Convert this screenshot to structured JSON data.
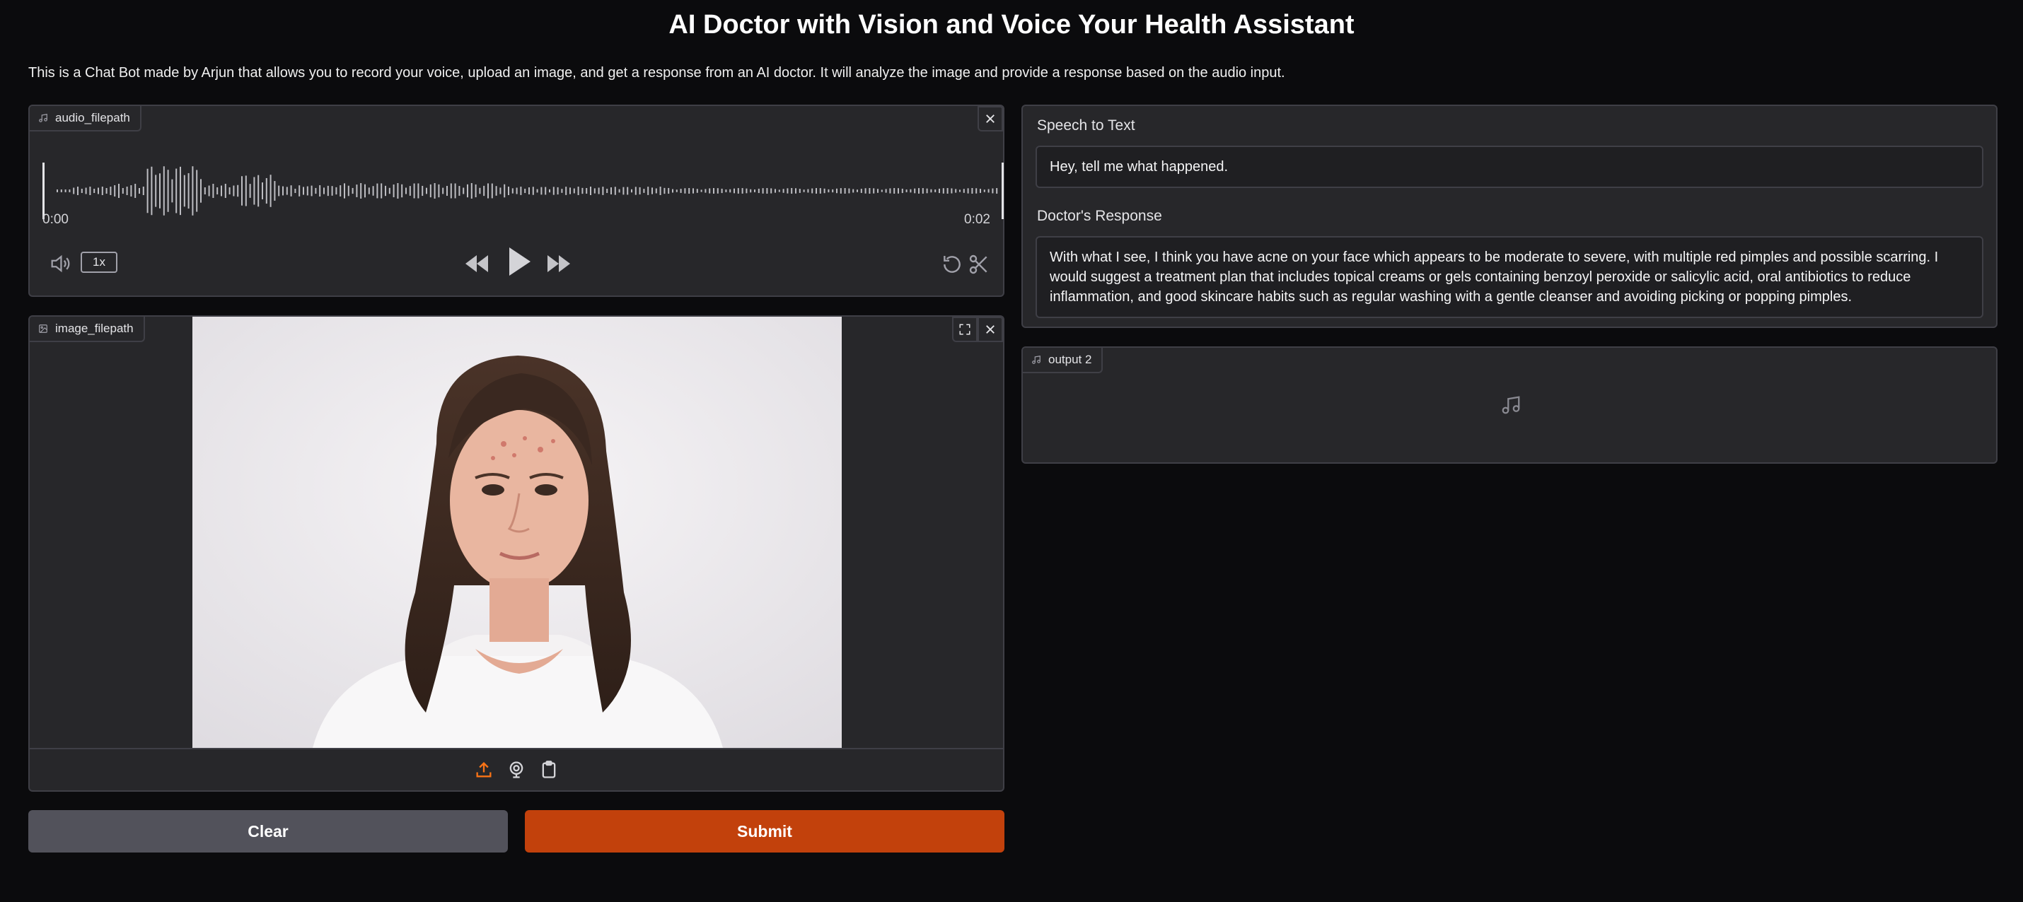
{
  "header": {
    "title": "AI Doctor with Vision and Voice Your Health Assistant",
    "description": "This is a Chat Bot made by Arjun that allows you to record your voice, upload an image, and get a response from an AI doctor. It will analyze the image and provide a response based on the audio input."
  },
  "audio_input": {
    "label": "audio_filepath",
    "time_start": "0:00",
    "time_end": "0:02",
    "speed": "1x"
  },
  "image_input": {
    "label": "image_filepath"
  },
  "buttons": {
    "clear": "Clear",
    "submit": "Submit"
  },
  "outputs": {
    "speech_label": "Speech to Text",
    "speech_value": "Hey, tell me what happened.",
    "response_label": "Doctor's Response",
    "response_value": "With what I see, I think you have acne on your face which appears to be moderate to severe, with multiple red pimples and possible scarring. I would suggest a treatment plan that includes topical creams or gels containing benzoyl peroxide or salicylic acid, oral antibiotics to reduce inflammation, and good skincare habits such as regular washing with a gentle cleanser and avoiding picking or popping pimples.",
    "audio_label": "output 2"
  },
  "colors": {
    "accent": "#c2410c",
    "clear_button": "#52525b",
    "panel_bg": "#27272a",
    "page_bg": "#0b0b0d"
  }
}
